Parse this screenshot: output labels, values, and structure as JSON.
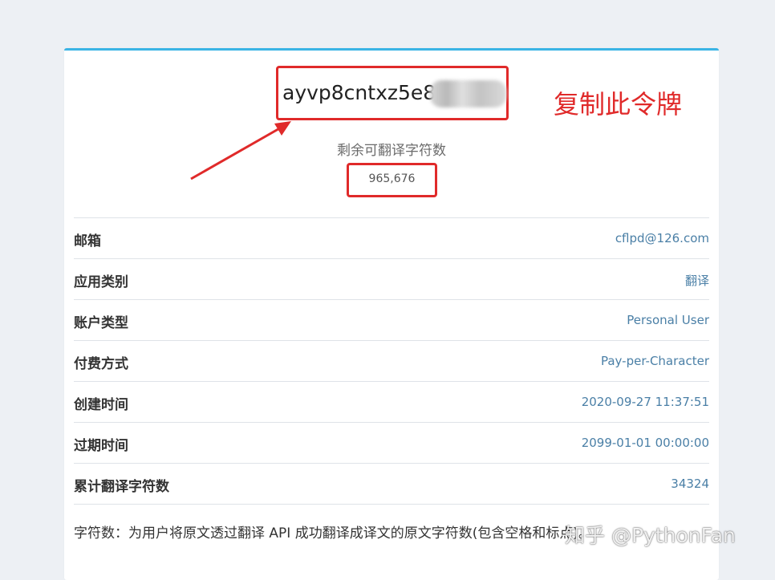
{
  "token": "ayvp8cntxz5e8",
  "annotation": "复制此令牌",
  "remaining": {
    "label": "剩余可翻译字符数",
    "value": "965,676"
  },
  "details": [
    {
      "label": "邮箱",
      "value": "cflpd@126.com"
    },
    {
      "label": "应用类别",
      "value": "翻译"
    },
    {
      "label": "账户类型",
      "value": "Personal User"
    },
    {
      "label": "付费方式",
      "value": "Pay-per-Character"
    },
    {
      "label": "创建时间",
      "value": "2020-09-27 11:37:51"
    },
    {
      "label": "过期时间",
      "value": "2099-01-01 00:00:00"
    },
    {
      "label": "累计翻译字符数",
      "value": "34324"
    }
  ],
  "footnote": "字符数：为用户将原文透过翻译 API 成功翻译成译文的原文字符数(包含空格和标点)。",
  "watermark": "知乎 @PythonFan",
  "colors": {
    "accent_top": "#3bb4e5",
    "annotation_red": "#e02a2a",
    "value_blue": "#4a7fa6",
    "background": "#edf0f4"
  }
}
